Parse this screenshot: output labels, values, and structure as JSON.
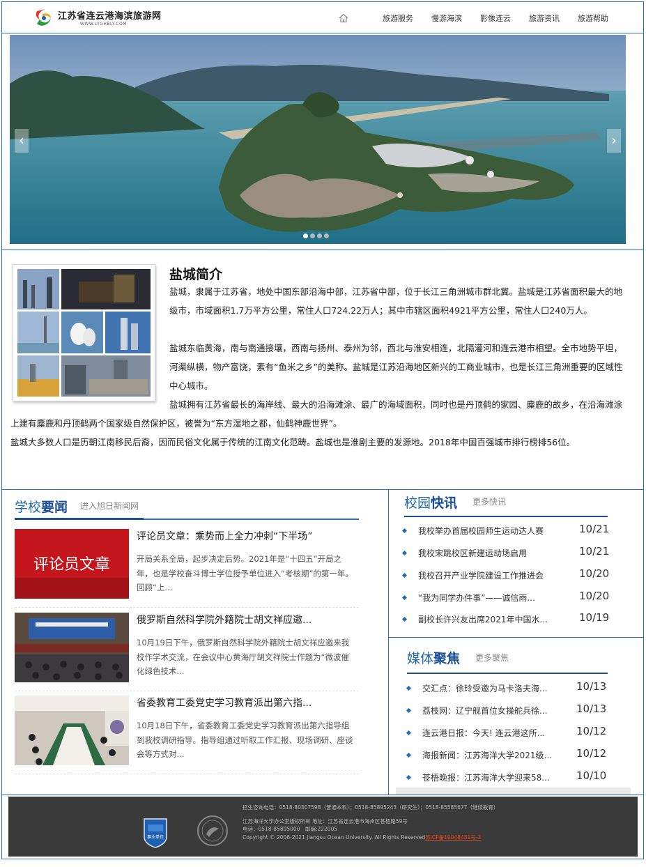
{
  "header": {
    "logo_title": "江苏省连云港海滨旅游网",
    "logo_subtitle": "WWW.LYGHBLY.COM",
    "nav": [
      "旅游服务",
      "慢游海滨",
      "影像连云",
      "旅游资讯",
      "旅游帮助"
    ]
  },
  "banner": {
    "prev_arrow": "‹",
    "next_arrow": "›",
    "slide_count": 4,
    "active_slide": 1
  },
  "intro": {
    "title": "盐城简介",
    "p1": "盐城，隶属于江苏省，地处中国东部沿海中部，江苏省中部，位于长江三角洲城市群北翼。盐城是江苏省面积最大的地级市，市域面积1.7万平方公里，常住人口724.22万人；其中市辖区面积4921平方公里，常住人口240万人。",
    "p2": "盐城东临黄海，南与南通接壤，西南与扬州、泰州为邻，西北与淮安相连，北隔灌河和连云港市相望。全市地势平坦，河渠纵横，物产富饶，素有“鱼米之乡”的美称。盐城是江苏沿海地区新兴的工商业城市，也是长江三角洲重要的区域性中心城市。",
    "p3": "盐城拥有江苏省最长的海岸线、最大的沿海滩涂、最广的海域面积，同时也是丹顶鹤的家园、麋鹿的故乡，在沿海滩涂上建有麋鹿和丹顶鹤两个国家级自然保护区，被誉为“东方湿地之都，仙鹤神鹿世界”。",
    "p4": "盐城大多数人口是历朝江南移民后裔，因而民俗文化属于传统的江南文化范畴。盐城也是淮剧主要的发源地。2018年中国百强城市排行榜排56位。"
  },
  "school_news": {
    "title_a": "学校",
    "title_b": "要闻",
    "more": "进入旭日新闻网",
    "items": [
      {
        "thumb_text": "评论员文章",
        "headline": "评论员文章：乘势而上全力冲刺“下半场”",
        "summary": "开局关系全局，起步决定后势。2021年是“十四五”开局之年，也是学校奋斗博士学位授予单位进入“考核期”的第一年。回顾“上..."
      },
      {
        "thumb_text": "",
        "headline": "俄罗斯自然科学院外籍院士胡文祥应邀...",
        "summary": "10月19日下午，俄罗斯自然科学院外籍院士胡文祥应邀来我校作学术交流，在会议中心黄海厅胡文祥院士作题为“微波催化绿色技术..."
      },
      {
        "thumb_text": "",
        "headline": "省委教育工委党史学习教育派出第六指...",
        "summary": "10月18日下午，省委教育工委党史学习教育派出第六指导组到我校调研指导。指导组通过听取工作汇报、现场调研、座谈会等方式对..."
      }
    ]
  },
  "campus_news": {
    "title_a": "校园",
    "title_b": "快讯",
    "more": "更多快讯",
    "items": [
      {
        "text": "我校举办首届校园师生运动达人赛",
        "date": "10/21"
      },
      {
        "text": "我校宋跳校区新建运动场启用",
        "date": "10/21"
      },
      {
        "text": "我校召开产业学院建设工作推进会",
        "date": "10/20"
      },
      {
        "text": "“我为同学办件事”——诚信雨...",
        "date": "10/20"
      },
      {
        "text": "副校长许兴友出席2021年中国水...",
        "date": "10/19"
      }
    ]
  },
  "media_focus": {
    "title_a": "媒体",
    "title_b": "聚焦",
    "more": "更多聚焦",
    "items": [
      {
        "text": "交汇点：徐玲受邀为马卡洛夫海...",
        "date": "10/13"
      },
      {
        "text": "荔枝网：辽宁舰首位女操舵兵徐...",
        "date": "10/13"
      },
      {
        "text": "连云港日报：今天! 连云港这所...",
        "date": "10/12"
      },
      {
        "text": "海报新闻：江苏海洋大学2021级...",
        "date": "10/12"
      },
      {
        "text": "苍梧晚报：江苏海洋大学迎来58...",
        "date": "10/10"
      }
    ]
  },
  "footer": {
    "line1": "招生咨询电话：0518-80307598（普通本科）；0518-85895243（研究生）；0518-85585677（继续教育）",
    "line2": "江苏海洋大学办公室版权所有 地址：江苏省连云港市海州区苍梧路59号",
    "line3": "电话：0518-85895000　邮编:222005",
    "line4": "Copyright © 2006-2021 Jiangsu Ocean University. All Rights Reserved",
    "icp": "苏ICP备10048431号-3",
    "badge1_text": "事业单位"
  }
}
